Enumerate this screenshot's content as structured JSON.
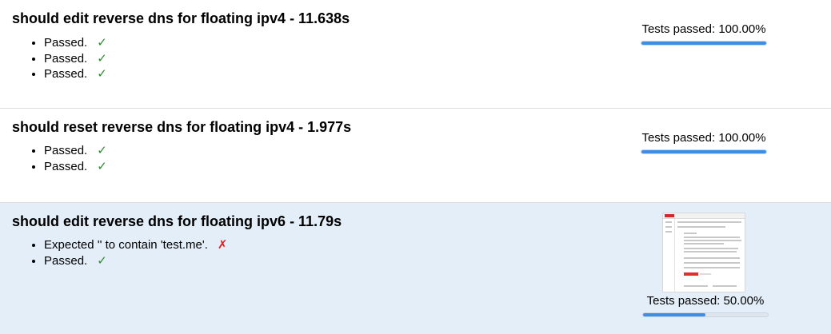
{
  "tests": [
    {
      "title": "should edit reverse dns for floating ipv4 - 11.638s",
      "results": [
        {
          "text": "Passed.",
          "status": "passed",
          "mark": "✓"
        },
        {
          "text": "Passed.",
          "status": "passed",
          "mark": "✓"
        },
        {
          "text": "Passed.",
          "status": "passed",
          "mark": "✓"
        }
      ],
      "summary": "Tests passed: 100.00%",
      "progress": 1.0
    },
    {
      "title": "should reset reverse dns for floating ipv4 - 1.977s",
      "results": [
        {
          "text": "Passed.",
          "status": "passed",
          "mark": "✓"
        },
        {
          "text": "Passed.",
          "status": "passed",
          "mark": "✓"
        }
      ],
      "summary": "Tests passed: 100.00%",
      "progress": 1.0
    },
    {
      "title": "should edit reverse dns for floating ipv6 - 11.79s",
      "results": [
        {
          "text": "Expected '' to contain 'test.me'.",
          "status": "failed",
          "mark": "✗"
        },
        {
          "text": "Passed.",
          "status": "passed",
          "mark": "✓"
        }
      ],
      "summary": "Tests passed: 50.00%",
      "progress": 0.5,
      "has_screenshot": true
    }
  ],
  "colors": {
    "pass": "#2e8b2e",
    "fail": "#e02020",
    "progress_fill": "#3d8ee5",
    "failed_row_bg": "#e3eef8"
  }
}
